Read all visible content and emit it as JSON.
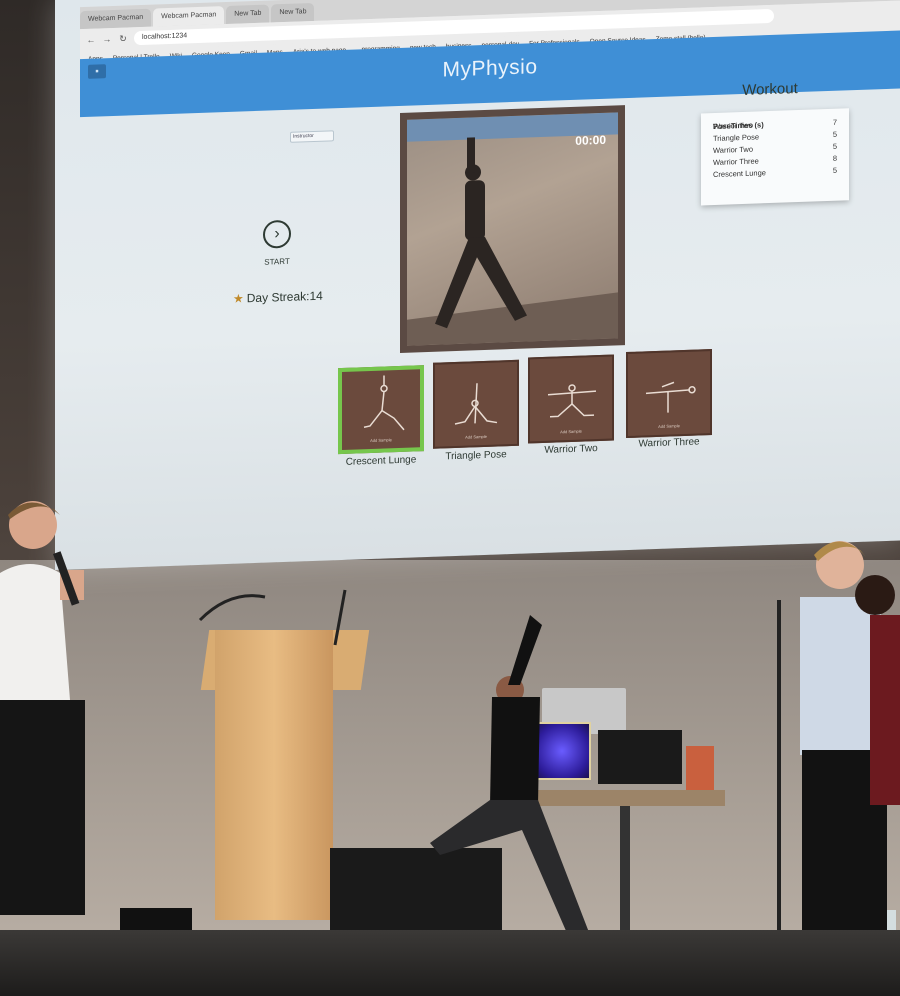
{
  "browser": {
    "tabs": [
      "Webcam Pacman",
      "Webcam Pacman",
      "New Tab",
      "New Tab"
    ],
    "address": "localhost:1234",
    "bookmarks": [
      "Apps",
      "Personal | Trello",
      "Wiki",
      "Google Keep",
      "Gmail",
      "Maps",
      "Aria's to web page...",
      "programming",
      "new tech",
      "business",
      "personal-dev",
      "For Professionals",
      "Open Source Ideas",
      "Zomo stall (hello)"
    ]
  },
  "app": {
    "title": "MyPhysio",
    "role_select": "Instructor",
    "start_label": "START",
    "streak_text": "Day Streak:14",
    "timer": "00:00",
    "workout": {
      "title": "Workout",
      "col_pose": "Pose",
      "col_times": "Times (s)",
      "rows": [
        {
          "pose": "Warrior Two",
          "time": "7"
        },
        {
          "pose": "Triangle Pose",
          "time": "5"
        },
        {
          "pose": "Warrior Two",
          "time": "5"
        },
        {
          "pose": "Warrior Three",
          "time": "8"
        },
        {
          "pose": "Crescent Lunge",
          "time": "5"
        }
      ]
    },
    "poses": [
      {
        "label": "Crescent Lunge",
        "caption": "Add Sample",
        "selected": true
      },
      {
        "label": "Triangle Pose",
        "caption": "Add Sample",
        "selected": false
      },
      {
        "label": "Warrior Two",
        "caption": "Add Sample",
        "selected": false
      },
      {
        "label": "Warrior Three",
        "caption": "Add Sample",
        "selected": false
      }
    ]
  },
  "colors": {
    "header": "#3f8fd6",
    "selected_border": "#76c64c",
    "card_bg": "#6b4a3d"
  }
}
